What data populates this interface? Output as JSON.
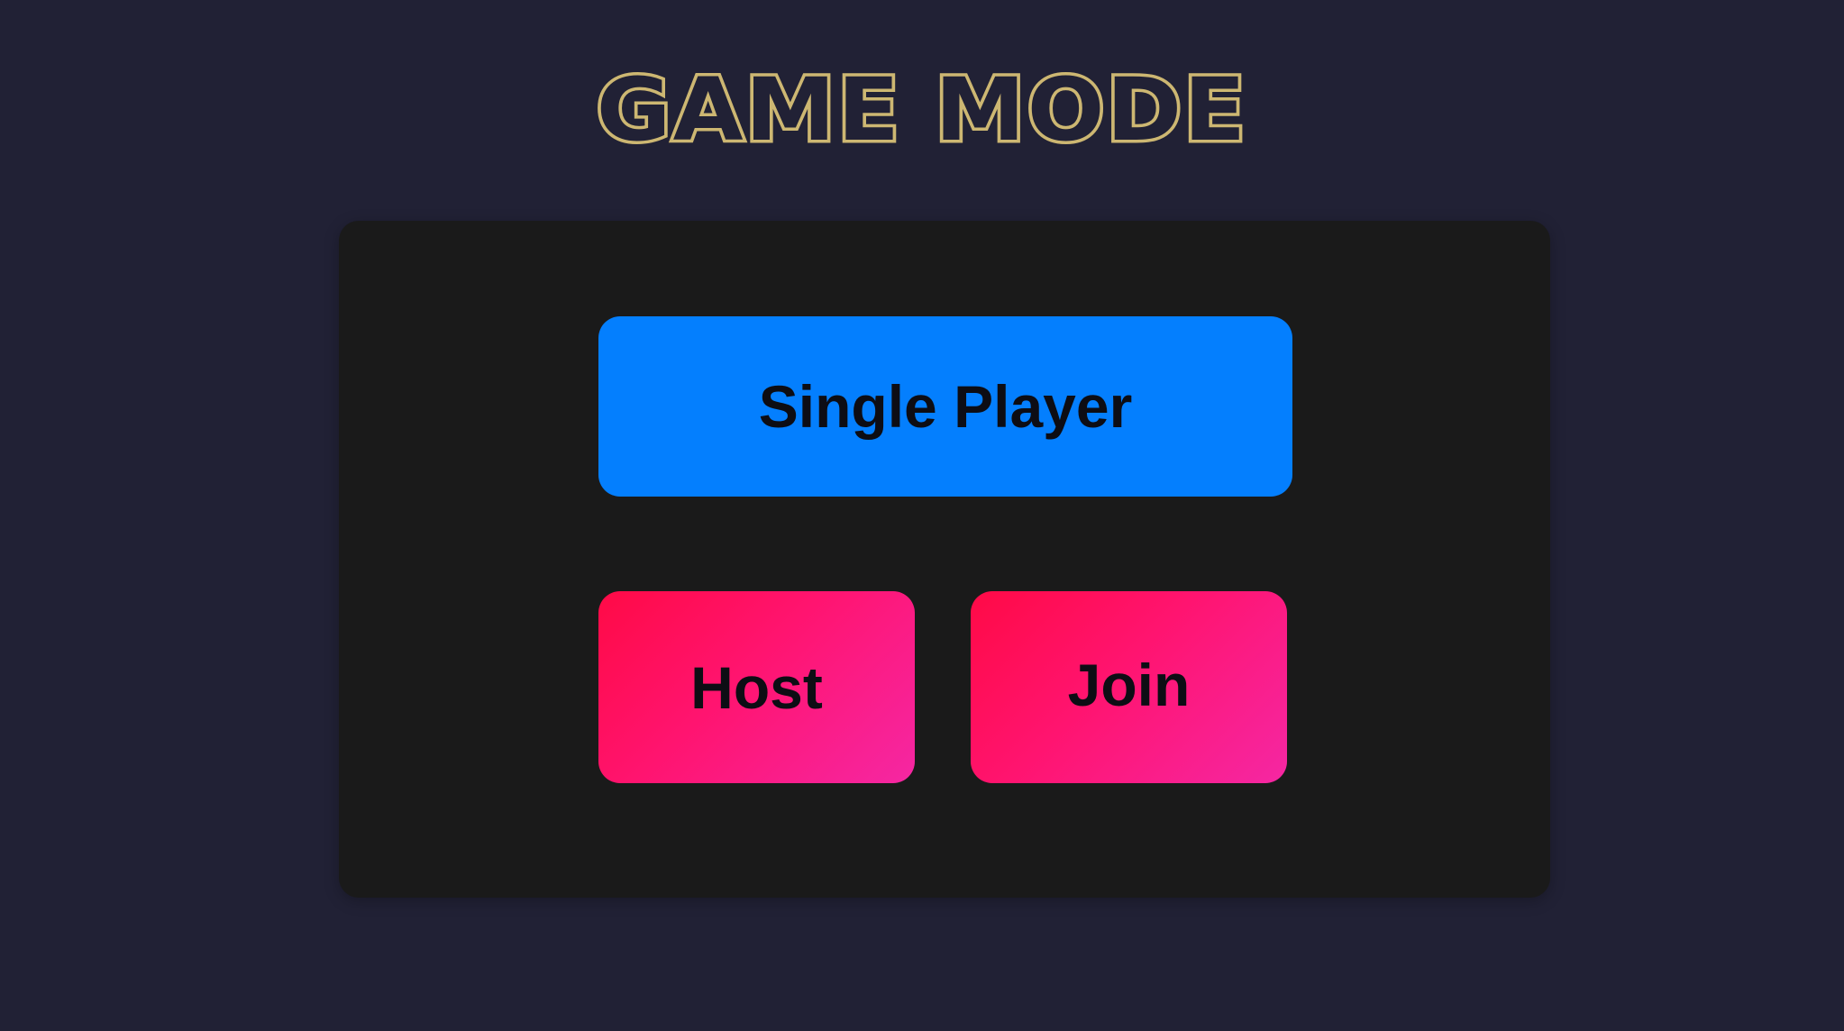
{
  "title": "GAME MODE",
  "buttons": {
    "single_player": "Single Player",
    "host": "Host",
    "join": "Join"
  },
  "colors": {
    "background": "#212135",
    "panel": "#1a1a1a",
    "title_gold": "#cdb772",
    "single_player_blue": "#047ffe",
    "multiplayer_gradient_start": "#ff0a46",
    "multiplayer_gradient_end": "#f527a3"
  }
}
